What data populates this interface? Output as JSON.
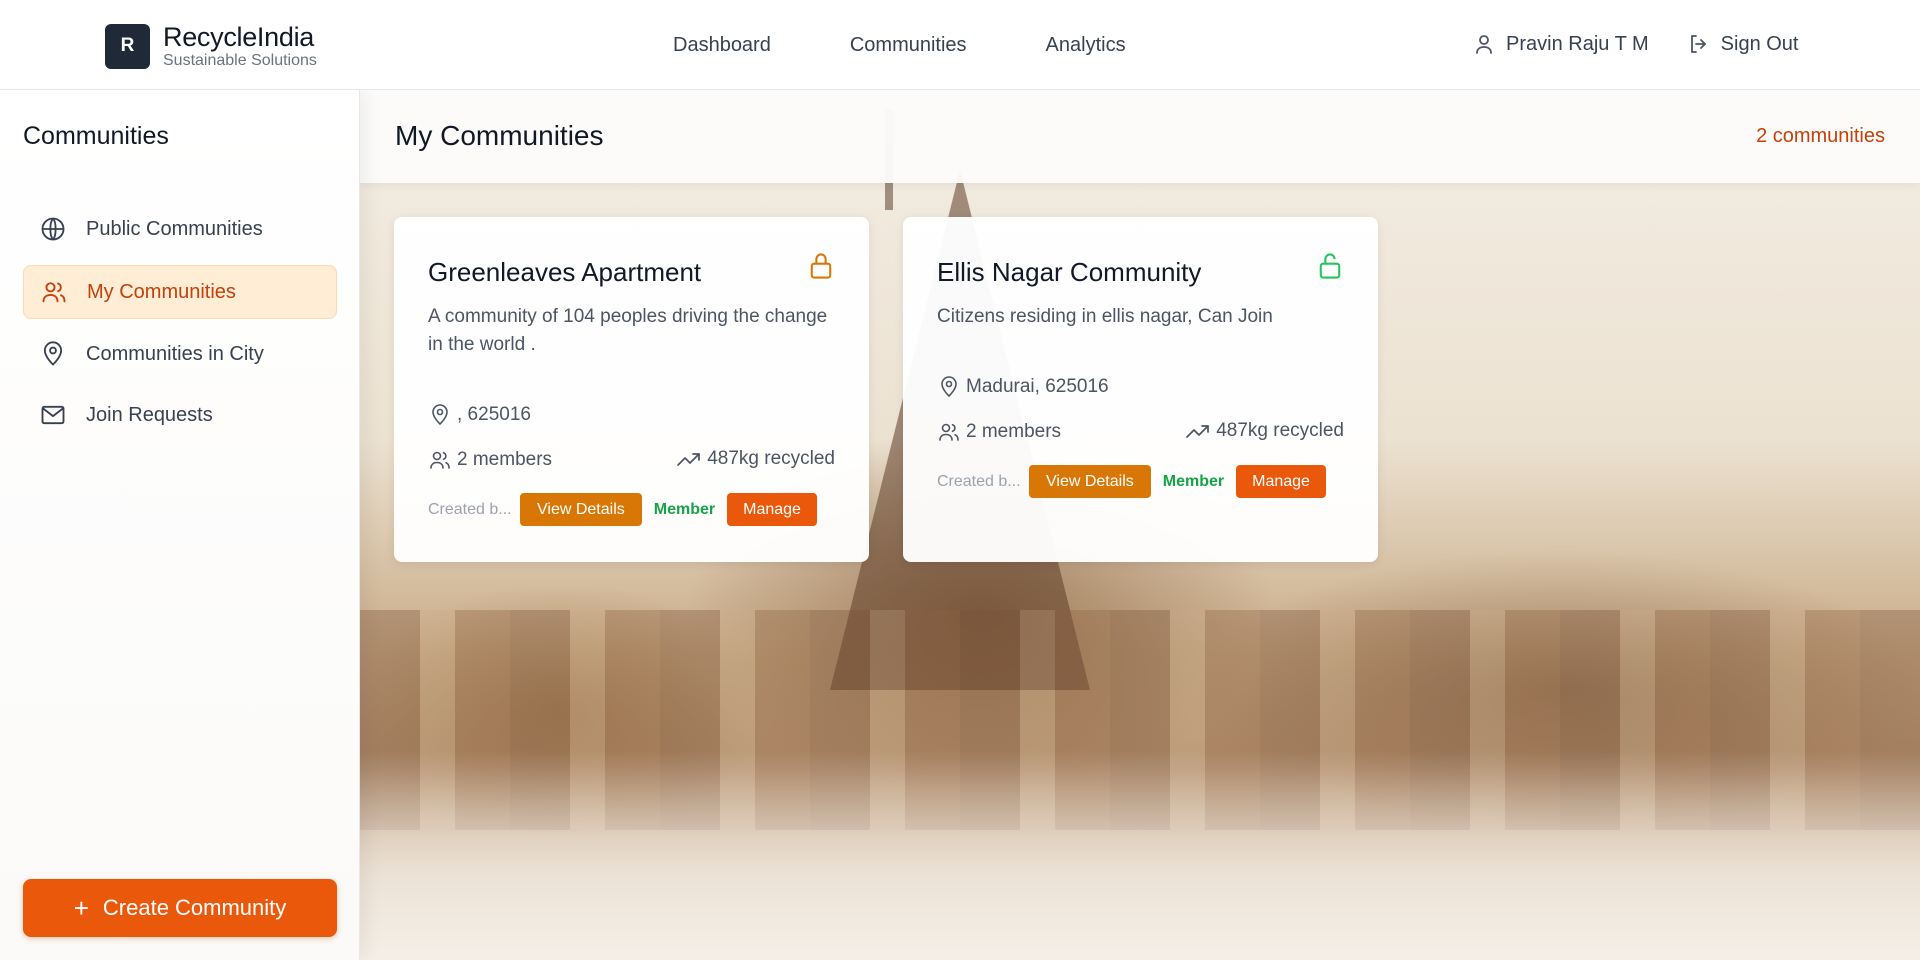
{
  "brand": {
    "logo_letter": "R",
    "name": "RecycleIndia",
    "tagline": "Sustainable Solutions"
  },
  "nav": {
    "items": [
      "Dashboard",
      "Communities",
      "Analytics"
    ]
  },
  "user": {
    "name": "Pravin Raju T M",
    "signout_label": "Sign Out"
  },
  "sidebar": {
    "title": "Communities",
    "items": [
      {
        "label": "Public Communities",
        "icon": "globe-icon",
        "active": false
      },
      {
        "label": "My Communities",
        "icon": "users-icon",
        "active": true
      },
      {
        "label": "Communities in City",
        "icon": "map-pin-icon",
        "active": false
      },
      {
        "label": "Join Requests",
        "icon": "mail-icon",
        "active": false
      }
    ],
    "create_button": {
      "icon": "+",
      "label": "Create Community"
    }
  },
  "main": {
    "title": "My Communities",
    "count": "2 communities"
  },
  "cards": [
    {
      "title": "Greenleaves Apartment",
      "lock_icon": "lock-closed-icon",
      "lock_color": "#d97706",
      "description": "A community of 104 peoples driving the change in the world .",
      "location": ", 625016",
      "members": "2 members",
      "recycled": "487kg recycled",
      "created": "Created b...",
      "view_label": "View Details",
      "member_label": "Member",
      "manage_label": "Manage"
    },
    {
      "title": "Ellis Nagar Community",
      "lock_icon": "lock-open-icon",
      "lock_color": "#22c55e",
      "description": "Citizens residing in ellis nagar, Can Join",
      "location": "Madurai, 625016",
      "members": "2 members",
      "recycled": "487kg recycled",
      "created": "Created b...",
      "view_label": "View Details",
      "member_label": "Member",
      "manage_label": "Manage"
    }
  ],
  "colors": {
    "accent": "#ea580c",
    "accent_dark": "#c2410c",
    "view_button": "#d97706",
    "member_text": "#16a34a",
    "active_bg": "#ffedd5"
  }
}
